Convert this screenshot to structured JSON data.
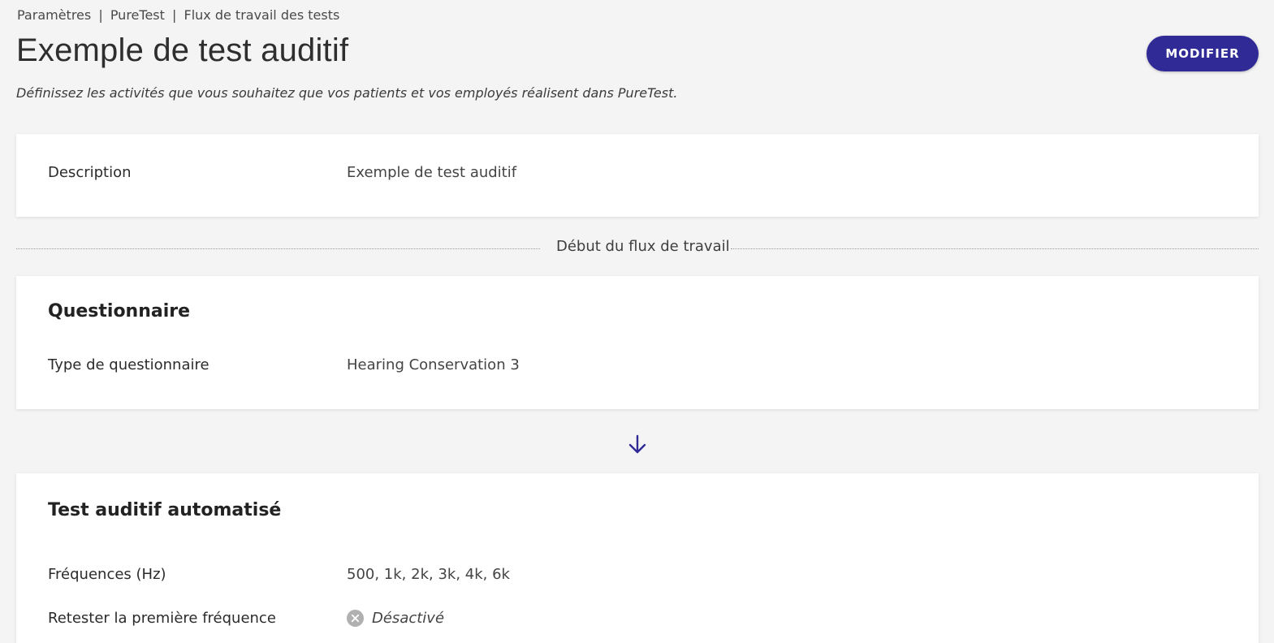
{
  "breadcrumb": {
    "items": [
      "Paramètres",
      "PureTest",
      "Flux de travail des tests"
    ],
    "separator": "|"
  },
  "header": {
    "title": "Exemple de test auditif",
    "subtitle": "Définissez les activités que vous souhaitez que vos patients et vos employés réalisent dans PureTest.",
    "edit_label": "MODIFIER"
  },
  "description_card": {
    "label": "Description",
    "value": "Exemple de test auditif"
  },
  "workflow": {
    "start_label": "Début du flux de travail"
  },
  "questionnaire_card": {
    "title": "Questionnaire",
    "type_label": "Type de questionnaire",
    "type_value": "Hearing Conservation 3"
  },
  "flow_icon": "arrow-down-icon",
  "test_card": {
    "title": "Test auditif automatisé",
    "frequencies_label": "Fréquences (Hz)",
    "frequencies_value": "500, 1k, 2k, 3k, 4k, 6k",
    "retest_label": "Retester la première fréquence",
    "retest_status": "Désactivé",
    "retest_icon": "x-circle-icon"
  },
  "colors": {
    "accent": "#2f2a96",
    "background": "#f4f4f4",
    "card": "#ffffff",
    "disabled_icon": "#b0b0b0"
  }
}
